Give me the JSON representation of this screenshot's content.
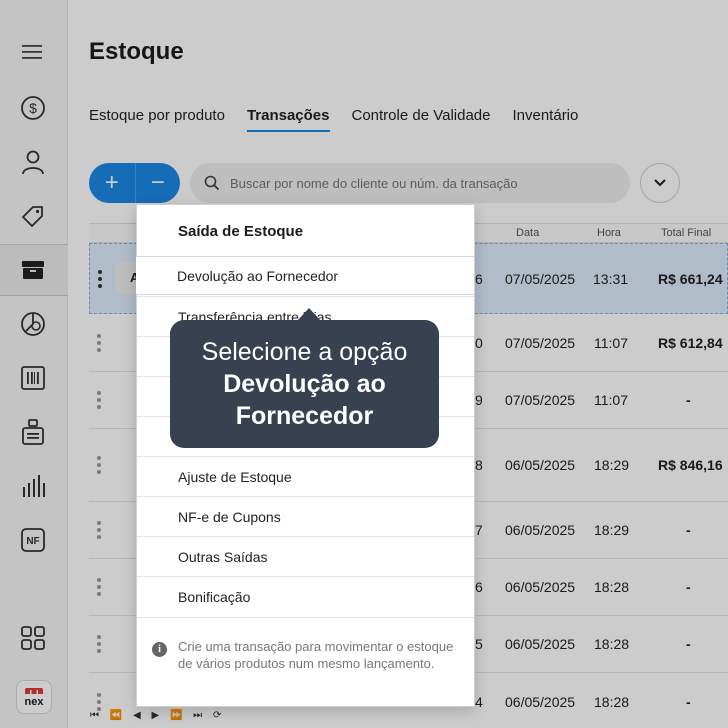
{
  "app": {
    "brand": "nex",
    "brand_color": "#e03a3a",
    "accent": "#1b87e5"
  },
  "sidebar": {
    "icons": [
      "menu-icon",
      "dollar-icon",
      "user-icon",
      "tag-icon",
      "box-icon",
      "chart-donut-icon",
      "barcode-icon",
      "clipboard-icon",
      "bar-chart-icon",
      "nf-icon",
      "grid-icon"
    ],
    "nf_label": "NF"
  },
  "header": {
    "title": "Estoque"
  },
  "tabs": [
    {
      "label": "Estoque por produto",
      "active": false
    },
    {
      "label": "Transações",
      "active": true
    },
    {
      "label": "Controle de Validade",
      "active": false
    },
    {
      "label": "Inventário",
      "active": false
    }
  ],
  "toolbar": {
    "add_label": "+",
    "remove_label": "−"
  },
  "search": {
    "placeholder": "Buscar por nome do cliente ou núm. da transação"
  },
  "table": {
    "columns": [
      "ro",
      "Data",
      "Hora",
      "Total Final"
    ],
    "rows": [
      {
        "num": "6",
        "date": "07/05/2025",
        "time": "13:31",
        "total": "R$ 661,24",
        "chip": "A"
      },
      {
        "num": "0",
        "date": "07/05/2025",
        "time": "11:07",
        "total": "R$ 612,84"
      },
      {
        "num": "9",
        "date": "07/05/2025",
        "time": "11:07",
        "total": "-"
      },
      {
        "num": "8",
        "date": "06/05/2025",
        "time": "18:29",
        "total": "R$ 846,16"
      },
      {
        "num": "7",
        "date": "06/05/2025",
        "time": "18:29",
        "total": "-"
      },
      {
        "num": "6",
        "date": "06/05/2025",
        "time": "18:28",
        "total": "-"
      },
      {
        "num": "5",
        "date": "06/05/2025",
        "time": "18:28",
        "total": "-"
      },
      {
        "num": "4",
        "date": "06/05/2025",
        "time": "18:28",
        "total": "-"
      }
    ]
  },
  "pager": {
    "label": "⏮ ⏪ ◀ ▶ ⏩ ⏭ ⟳"
  },
  "menu": {
    "title": "Saída de Estoque",
    "items": [
      "Devolução ao Fornecedor",
      "Transferência entre lojas",
      "",
      "",
      "",
      "Ajuste de Estoque",
      "NF-e de Cupons",
      "Outras Saídas",
      "Bonificação"
    ],
    "footer": "Crie uma transação para movimentar o estoque de vários produtos num mesmo lançamento."
  },
  "tooltip": {
    "line1": "Selecione a opção",
    "line2": "Devolução ao Fornecedor"
  }
}
